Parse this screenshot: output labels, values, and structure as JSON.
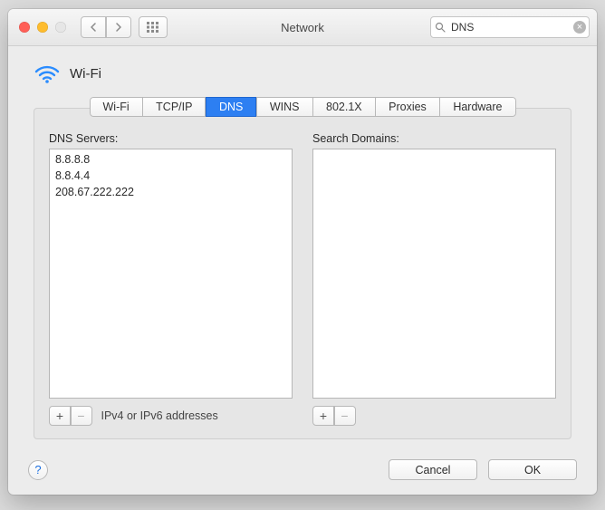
{
  "window": {
    "title": "Network",
    "search_value": "DNS"
  },
  "connection": {
    "name": "Wi-Fi"
  },
  "tabs": [
    {
      "label": "Wi-Fi",
      "active": false
    },
    {
      "label": "TCP/IP",
      "active": false
    },
    {
      "label": "DNS",
      "active": true
    },
    {
      "label": "WINS",
      "active": false
    },
    {
      "label": "802.1X",
      "active": false
    },
    {
      "label": "Proxies",
      "active": false
    },
    {
      "label": "Hardware",
      "active": false
    }
  ],
  "dns": {
    "label": "DNS Servers:",
    "servers": [
      "8.8.8.8",
      "8.8.4.4",
      "208.67.222.222"
    ],
    "hint": "IPv4 or IPv6 addresses"
  },
  "search_domains": {
    "label": "Search Domains:",
    "domains": []
  },
  "buttons": {
    "add": "+",
    "remove": "−",
    "cancel": "Cancel",
    "ok": "OK",
    "help": "?"
  }
}
